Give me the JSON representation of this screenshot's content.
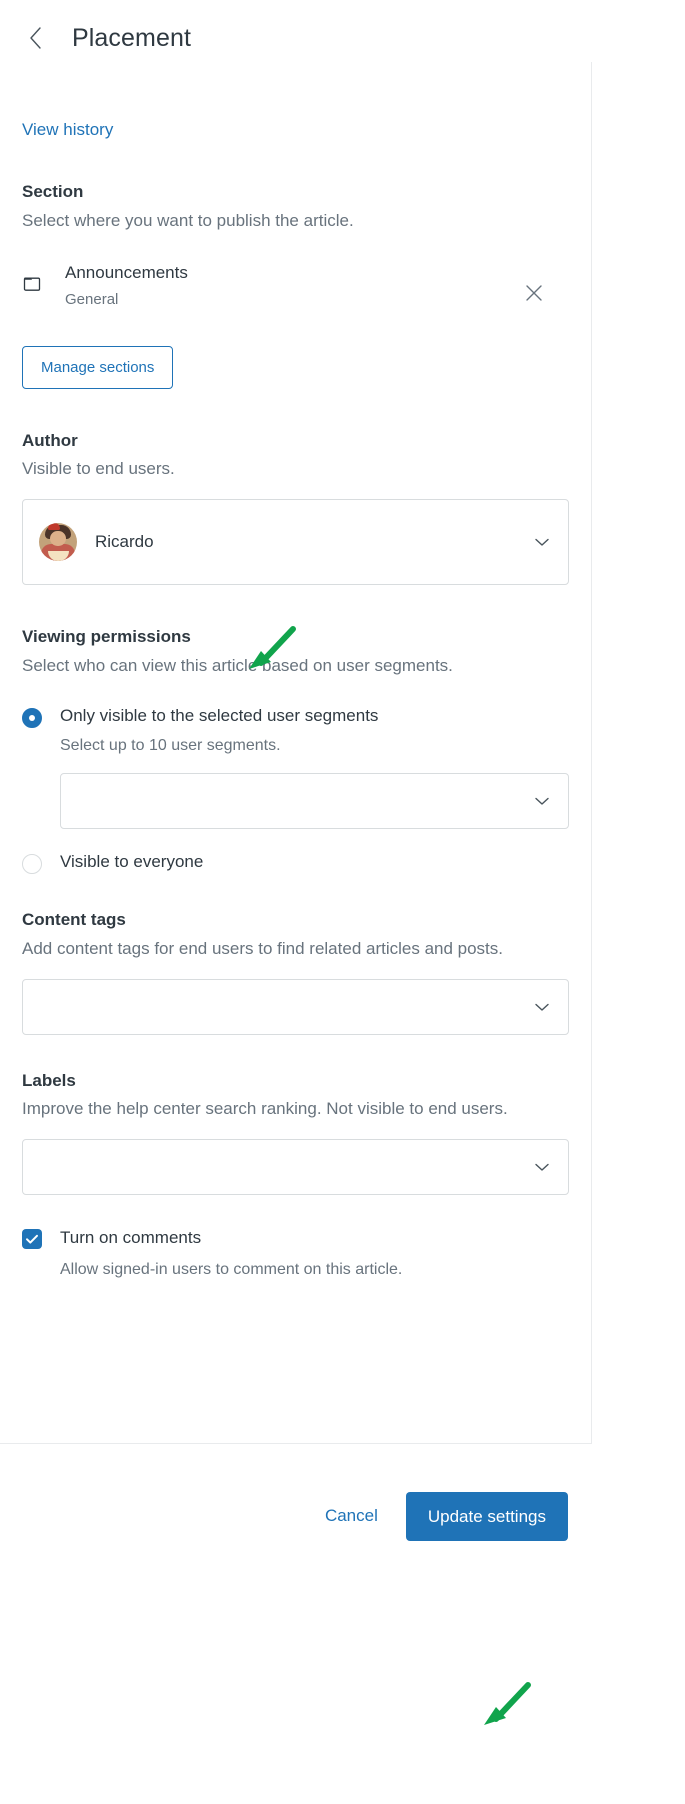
{
  "header": {
    "back_icon": "chevron-left-icon",
    "title": "Placement"
  },
  "links": {
    "view_history": "View history"
  },
  "section": {
    "title": "Section",
    "description": "Select where you want to publish the article.",
    "selected": {
      "icon": "folder-icon",
      "name": "Announcements",
      "parent": "General",
      "remove_icon": "close-icon"
    },
    "manage_button": "Manage sections"
  },
  "author": {
    "title": "Author",
    "description": "Visible to end users.",
    "selected_value": "Ricardo",
    "avatar": "user-avatar",
    "chevron": "chevron-down-icon"
  },
  "viewing_permissions": {
    "title": "Viewing permissions",
    "description": "Select who can view this article based on user segments.",
    "options": [
      {
        "label": "Only visible to the selected user segments",
        "sublabel": "Select up to 10 user segments.",
        "selected": true
      },
      {
        "label": "Visible to everyone",
        "sublabel": "",
        "selected": false
      }
    ],
    "segment_select_value": "",
    "segment_select_placeholder": ""
  },
  "content_tags": {
    "title": "Content tags",
    "description": "Add content tags for end users to find related articles and posts.",
    "value": ""
  },
  "labels": {
    "title": "Labels",
    "description": "Improve the help center search ranking. Not visible to end users.",
    "value": ""
  },
  "comments": {
    "label": "Turn on comments",
    "sublabel": "Allow signed-in users to comment on this article.",
    "checked": true,
    "check_icon": "check-icon"
  },
  "footer": {
    "cancel_label": "Cancel",
    "submit_label": "Update settings"
  },
  "annotations": [
    {
      "name": "arrow-to-viewing-permissions",
      "color": "#11a44c"
    },
    {
      "name": "arrow-to-update-settings",
      "color": "#11a44c"
    }
  ],
  "colors": {
    "accent": "#1f73b7",
    "text": "#2f3941",
    "muted": "#68737d",
    "border": "#d8dcde",
    "annotation": "#11a44c"
  }
}
